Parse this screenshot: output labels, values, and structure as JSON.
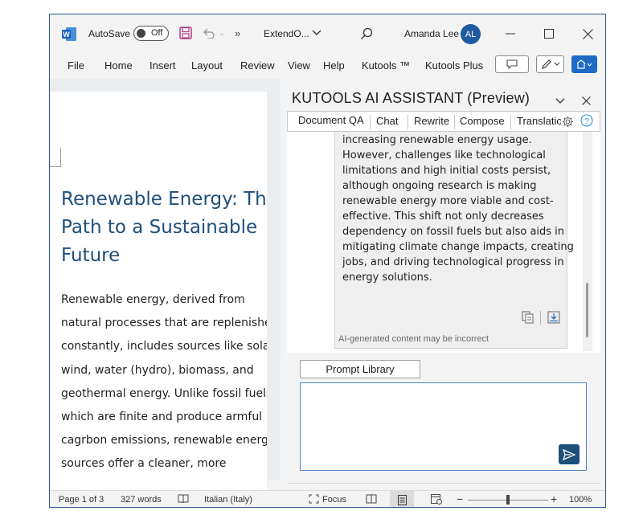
{
  "titlebar": {
    "autosave_label": "AutoSave",
    "autosave_state": "Off",
    "more_chevron": "»",
    "doc_name": "ExtendO...",
    "user_name": "Amanda Lee",
    "avatar_initials": "AL",
    "accent": "#2b5797"
  },
  "ribbon": {
    "items": [
      "File",
      "Home",
      "Insert",
      "Layout",
      "Review",
      "View",
      "Help",
      "Kutools ™",
      "Kutools Plus"
    ]
  },
  "document": {
    "title_lines": [
      "Renewable Energy: The",
      "Path to a Sustainable",
      "Future"
    ],
    "body": "Renewable energy, derived from\nnatural processes that are replenished\nconstantly, includes sources like solar,\nwind, water (hydro), biomass, and\ngeothermal energy. Unlike fossil fuels,\nwhich are finite and produce armful\ncagrbon emissions, renewable energy\nsources offer a cleaner, more",
    "title_color": "#1f4f7a"
  },
  "pane": {
    "title": "KUTOOLS AI ASSISTANT (Preview)",
    "tabs": [
      "Document QA",
      "Chat",
      "Rewrite",
      "Compose",
      "Translation"
    ],
    "response": "incentives, and setting targets for\nincreasing renewable energy usage.\nHowever, challenges like technological\nlimitations and high initial costs persist,\nalthough ongoing research is making\nrenewable energy more viable and cost-\neffective. This shift not only decreases\ndependency on fossil fuels but also aids in\nmitigating climate change impacts, creating\njobs, and driving technological progress in\nenergy solutions.",
    "disclaimer": "AI-generated content may be incorrect",
    "prompt_library": "Prompt Library",
    "send_color": "#1e4f7a"
  },
  "status": {
    "page": "Page 1 of 3",
    "words": "327 words",
    "language": "Italian (Italy)",
    "focus": "Focus",
    "zoom": "100%",
    "zoom_minus": "−",
    "zoom_plus": "+"
  }
}
